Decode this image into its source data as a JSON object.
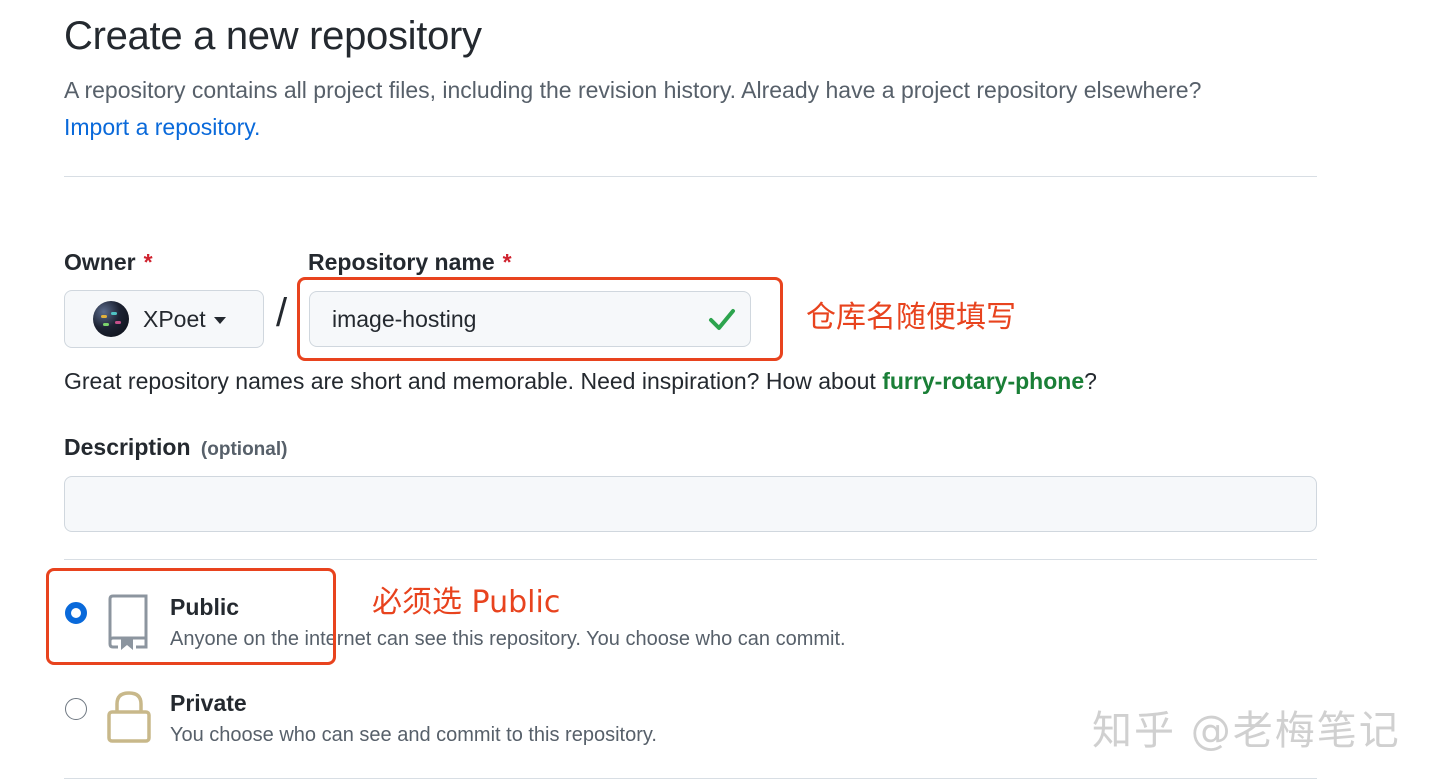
{
  "page": {
    "title": "Create a new repository",
    "intro_text": "A repository contains all project files, including the revision history. Already have a project repository elsewhere?",
    "import_link": "Import a repository."
  },
  "owner": {
    "label": "Owner",
    "required_mark": "*",
    "selected": "XPoet",
    "icon": "chevron-down-icon"
  },
  "separator": "/",
  "repository_name": {
    "label": "Repository name",
    "required_mark": "*",
    "value": "image-hosting",
    "valid_icon": "check-icon"
  },
  "name_hint": {
    "text": "Great repository names are short and memorable. Need inspiration? How about",
    "suggestion": "furry-rotary-phone",
    "suffix": "?"
  },
  "description": {
    "label": "Description",
    "optional_label": "(optional)",
    "value": ""
  },
  "visibility": {
    "options": [
      {
        "title": "Public",
        "description": "Anyone on the internet can see this repository. You choose who can commit.",
        "selected": true,
        "icon": "repo-icon"
      },
      {
        "title": "Private",
        "description": "You choose who can see and commit to this repository.",
        "selected": false,
        "icon": "lock-icon"
      }
    ]
  },
  "annotations": {
    "repo_name_note": "仓库名随便填写",
    "public_note": "必须选 Public"
  },
  "watermark": "知乎 @老梅笔记",
  "colors": {
    "link": "#0969da",
    "suggestion": "#1a7f37",
    "required": "#cf222e",
    "annotation": "#e8431e",
    "radio_selected": "#0969da",
    "check": "#2da44e"
  }
}
